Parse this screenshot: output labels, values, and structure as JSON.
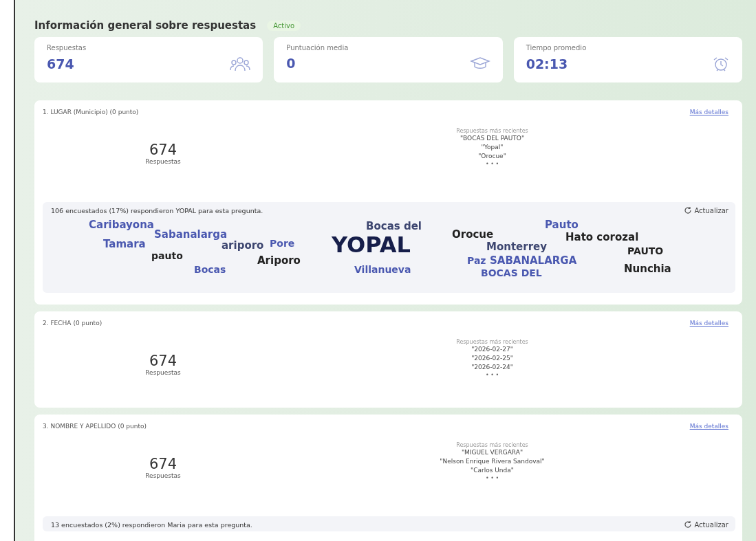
{
  "header": {
    "title": "Información general sobre respuestas",
    "badge": "Activo"
  },
  "stats": [
    {
      "label": "Respuestas",
      "value": "674"
    },
    {
      "label": "Puntuación media",
      "value": "0"
    },
    {
      "label": "Tiempo promedio",
      "value": "02:13"
    }
  ],
  "questions": [
    {
      "title": "1. LUGAR (Municipio) (0 punto)",
      "link": "Más detalles",
      "count": "674",
      "count_label": "Respuestas",
      "recent_label": "Respuestas más recientes",
      "recent": [
        "\"BOCAS DEL PAUTO\"",
        "\"Yopal\"",
        "\"Orocue\""
      ],
      "more": "• • •",
      "summary": {
        "text": "106 encuestados (17%) respondieron YOPAL para esta pregunta.",
        "refresh": "Actualizar"
      },
      "cloud": [
        {
          "text": "Caribayona",
          "color": "#4a58b0"
        },
        {
          "text": "Sabanalarga",
          "color": "#4a58b0"
        },
        {
          "text": "Tamara",
          "color": "#4a58b0"
        },
        {
          "text": "ariporo",
          "color": "#3d4670"
        },
        {
          "text": "Pore",
          "color": "#4a58b0"
        },
        {
          "text": "Bocas del",
          "color": "#3d4670"
        },
        {
          "text": "YOPAL",
          "color": "#161e4a"
        },
        {
          "text": "Orocue",
          "color": "#222222"
        },
        {
          "text": "Pauto",
          "color": "#4a58b0"
        },
        {
          "text": "Hato corozal",
          "color": "#222222"
        },
        {
          "text": "Monterrey",
          "color": "#3d4670"
        },
        {
          "text": "PAUTO",
          "color": "#222222"
        },
        {
          "text": "pauto",
          "color": "#222222"
        },
        {
          "text": "Ariporo",
          "color": "#222222"
        },
        {
          "text": "Paz",
          "color": "#4a58b0"
        },
        {
          "text": "SABANALARGA",
          "color": "#4a58b0"
        },
        {
          "text": "Bocas",
          "color": "#4a58b0"
        },
        {
          "text": "Villanueva",
          "color": "#4a58b0"
        },
        {
          "text": "BOCAS DEL",
          "color": "#4a58b0"
        },
        {
          "text": "Nunchia",
          "color": "#222222"
        }
      ]
    },
    {
      "title": "2. FECHA (0 punto)",
      "link": "Más detalles",
      "count": "674",
      "count_label": "Respuestas",
      "recent_label": "Respuestas más recientes",
      "recent": [
        "\"2026-02-27\"",
        "\"2026-02-25\"",
        "\"2026-02-24\""
      ],
      "more": "• • •"
    },
    {
      "title": "3. NOMBRE Y APELLIDO (0 punto)",
      "link": "Más detalles",
      "count": "674",
      "count_label": "Respuestas",
      "recent_label": "Respuestas más recientes",
      "recent": [
        "\"MIGUEL VERGARA\"",
        "\"Nelson Enrique Rivera Sandoval\"",
        "\"Carlos Unda\""
      ],
      "more": "• • •",
      "summary": {
        "text": "13 encuestados (2%) respondieron Maria para esta pregunta.",
        "refresh": "Actualizar"
      }
    }
  ]
}
